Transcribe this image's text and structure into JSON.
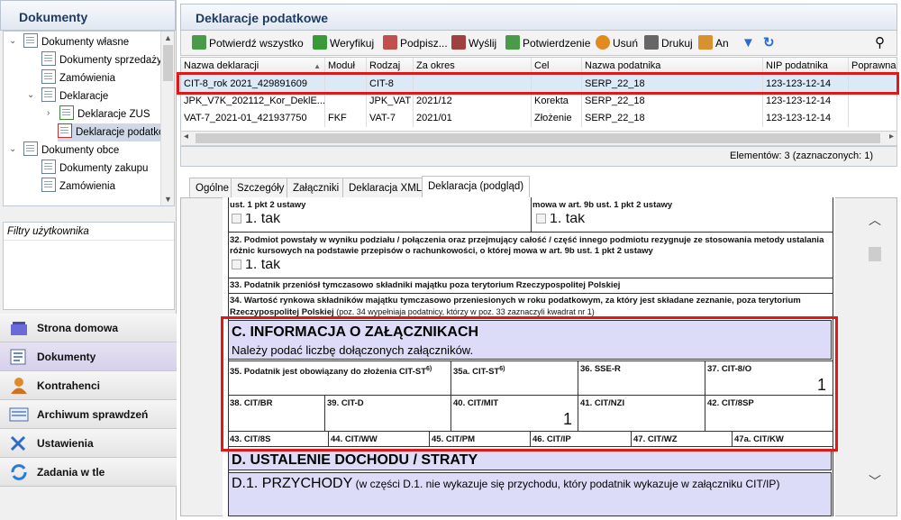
{
  "left": {
    "title": "Dokumenty",
    "tree": [
      "Dokumenty własne",
      "Dokumenty sprzedaży",
      "Zamówienia",
      "Deklaracje",
      "Deklaracje ZUS",
      "Deklaracje podatkowe",
      "Dokumenty obce",
      "Dokumenty zakupu",
      "Zamówienia"
    ],
    "filters_label": "Filtry użytkownika",
    "nav": [
      "Strona domowa",
      "Dokumenty",
      "Kontrahenci",
      "Archiwum sprawdzeń",
      "Ustawienia",
      "Zadania w tle"
    ]
  },
  "right": {
    "title": "Deklaracje podatkowe",
    "toolbar": [
      "Potwierdź wszystko",
      "Weryfikuj",
      "Podpisz...",
      "Wyślij",
      "Potwierdzenie",
      "Usuń",
      "Drukuj",
      "An"
    ],
    "columns": [
      "Nazwa deklaracji",
      "Moduł",
      "Rodzaj",
      "Za okres",
      "Cel",
      "Nazwa podatnika",
      "NIP podatnika",
      "Poprawna"
    ],
    "rows": [
      [
        "CIT-8_rok 2021_429891609",
        "",
        "CIT-8",
        "",
        "",
        "SERP_22_18",
        "123-123-12-14",
        ""
      ],
      [
        "JPK_V7K_202112_Kor_DeklE...",
        "",
        "JPK_VAT",
        "2021/12",
        "Korekta",
        "SERP_22_18",
        "123-123-12-14",
        ""
      ],
      [
        "VAT-7_2021-01_421937750",
        "FKF",
        "VAT-7",
        "2021/01",
        "Złożenie",
        "SERP_22_18",
        "123-123-12-14",
        ""
      ]
    ],
    "count": "Elementów: 3 (zaznaczonych: 1)",
    "tabs": [
      "Ogólne",
      "Szczegóły",
      "Załączniki",
      "Deklaracja XML",
      "Deklaracja (podgląd)"
    ]
  },
  "form": {
    "r1a": "ust. 1 pkt 2 ustawy",
    "r1b": "mowa w art. 9b ust. 1 pkt 2 ustawy",
    "tak": "1. tak",
    "f32": "32. Podmiot powstały w wyniku podziału / połączenia oraz przejmujący całość / część innego podmiotu rezygnuje ze stosowania metody ustalania różnic kursowych na podstawie przepisów o rachunkowości, o której mowa w art. 9b ust. 1 pkt 2 ustawy",
    "f33": "33. Podatnik przeniósł tymczasowo składniki majątku poza terytorium Rzeczypospolitej Polskiej",
    "f34": "34. Wartość rynkowa składników majątku tymczasowo przeniesionych w roku podatkowym, za który jest składane zeznanie, poza terytorium Rzeczypospolitej Polskiej",
    "f34note": "(poz. 34 wypełniaja podatnicy, którzy w poz. 33 zaznaczyli kwadrat nr 1)",
    "secC": "C. INFORMACJA O ZAŁĄCZNIKACH",
    "secCsub": "Należy podać liczbę dołączonych załączników.",
    "f35": "35. Podatnik jest obowiązany do złożenia CIT-ST",
    "f35a": "35a. CIT-ST",
    "sup": "6)",
    "f36": "36. SSE-R",
    "f37": "37. CIT-8/O",
    "v37": "1",
    "f38": "38. CIT/BR",
    "f39": "39. CIT-D",
    "f40": "40. CIT/MIT",
    "v40": "1",
    "f41": "41. CIT/NZI",
    "f42": "42. CIT/8SP",
    "f43": "43. CIT/8S",
    "f44": "44. CIT/WW",
    "f45": "45. CIT/PM",
    "f46": "46. CIT/IP",
    "f47": "47. CIT/WZ",
    "f47a": "47a. CIT/KW",
    "secD": "D. USTALENIE DOCHODU / STRATY",
    "secD1": "D.1. PRZYCHODY",
    "secD1sub": "(w części D.1. nie wykazuje się przychodu, który podatnik wykazuje w załączniku CIT/IP)"
  }
}
